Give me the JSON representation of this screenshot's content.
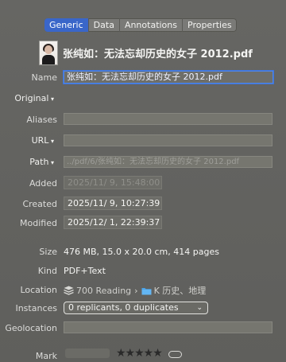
{
  "tabs": [
    {
      "label": "Generic",
      "active": true
    },
    {
      "label": "Data",
      "active": false
    },
    {
      "label": "Annotations",
      "active": false
    },
    {
      "label": "Properties",
      "active": false
    }
  ],
  "header": {
    "file_title": "张纯如：无法忘却历史的女子 2012.pdf",
    "thumbnail_icon": "portrait-thumbnail"
  },
  "fields": {
    "name_label": "Name",
    "name_value": "张纯如：无法忘却历史的女子 2012.pdf",
    "original_label": "Original",
    "aliases_label": "Aliases",
    "url_label": "URL",
    "path_label": "Path",
    "path_value": "../pdf/6/张纯如：无法忘却历史的女子 2012.pdf",
    "added_label": "Added",
    "added_value": "2025/11/ 9, 15:48:00",
    "created_label": "Created",
    "created_value": "2025/11/ 9, 10:27:39",
    "modified_label": "Modified",
    "modified_value": "2025/12/ 1, 22:39:37",
    "size_label": "Size",
    "size_value": "476 MB, 15.0 x 20.0 cm, 414 pages",
    "kind_label": "Kind",
    "kind_value": "PDF+Text",
    "location_label": "Location",
    "location_database": "700 Reading",
    "location_group": "K 历史、地理",
    "instances_label": "Instances",
    "instances_value": "0 replicants, 0 duplicates",
    "geolocation_label": "Geolocation",
    "mark_label": "Mark",
    "rating_stars": "★★★★★"
  },
  "colors": {
    "background": "#636360",
    "accent": "#3a66c9",
    "focus_ring": "#4f86e8"
  }
}
